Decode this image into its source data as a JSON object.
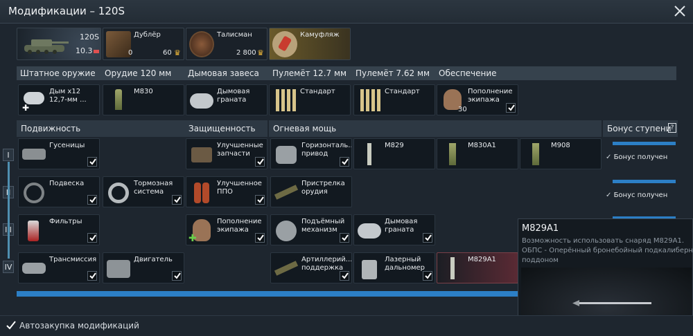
{
  "window": {
    "title": "Модификации – 120S"
  },
  "crew_row": {
    "vehicle": {
      "name": "120S",
      "br": "10.3"
    },
    "backup": {
      "label": "Дублёр",
      "count": "0",
      "price": "60"
    },
    "talisman": {
      "label": "Талисман",
      "price": "2 800"
    },
    "camo": {
      "label": "Камуфляж"
    }
  },
  "weapon_headers": [
    "Штатное оружие",
    "Орудие 120 мм",
    "Дымовая завеса",
    "Пулемёт 12.7 мм",
    "Пулемёт 7.62 мм",
    "Обеспечение"
  ],
  "weapon_cards": [
    {
      "label": "Дым х12\n12,7-мм ..."
    },
    {
      "label": "M830"
    },
    {
      "label": "Дымовая\nграната"
    },
    {
      "label": "Стандарт"
    },
    {
      "label": "Стандарт"
    },
    {
      "label": "Пополнение\nэкипажа",
      "count": "30"
    }
  ],
  "categories": {
    "mobility": "Подвижность",
    "protection": "Защищенность",
    "firepower": "Огневая мощь",
    "bonus": "Бонус ступени",
    "bonus_help": "?"
  },
  "tiers": [
    "I",
    "II",
    "III",
    "IV"
  ],
  "mods": {
    "tracks": "Гусеницы",
    "suspension": "Подвеска",
    "brakes": "Тормозная\nсистема",
    "filters": "Фильтры",
    "transmission": "Трансмиссия",
    "engine": "Двигатель",
    "parts": "Улучшенные\nзапчасти",
    "fpe": "Улучшенное\nППО",
    "crew": "Пополнение\nэкипажа",
    "horizontal": "Горизонталь...\nпривод",
    "m829": "M829",
    "m830a1": "M830A1",
    "m908": "M908",
    "adjust": "Пристрелка\nорудия",
    "elevation": "Подъёмный\nмеханизм",
    "smoke": "Дымовая\nграната",
    "artillery": "Артиллерий...\nподдержка",
    "rangefinder": "Лазерный\nдальномер",
    "m829a1": "M829A1"
  },
  "bonus_rows": [
    "Бонус получен",
    "Бонус получен"
  ],
  "tooltip": {
    "title": "M829A1",
    "line1": "Возможность использовать снаряд M829A1.",
    "line2": "ОБПС - Оперённый бронебойный подкалиберный",
    "line3": "поддоном"
  },
  "footer": {
    "autobuy_label": "Автозакупка модификаций",
    "autobuy_checked": true
  },
  "colors": {
    "accent": "#2c7fc6",
    "gold": "#f0b93a",
    "background": "#1e262f"
  }
}
